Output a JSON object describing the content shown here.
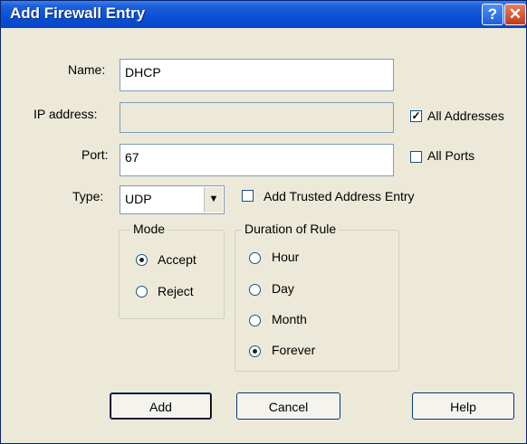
{
  "window": {
    "title": "Add Firewall Entry",
    "help_glyph": "?",
    "close_glyph": "✕"
  },
  "form": {
    "name_label": "Name:",
    "name_value": "DHCP",
    "ip_label": "IP address:",
    "ip_value": "",
    "port_label": "Port:",
    "port_value": "67",
    "type_label": "Type:",
    "type_value": "UDP",
    "all_addresses_label": "All Addresses",
    "all_addresses_checked": true,
    "all_ports_label": "All Ports",
    "all_ports_checked": false,
    "trusted_label": "Add Trusted Address Entry",
    "trusted_checked": false
  },
  "mode": {
    "title": "Mode",
    "accept_label": "Accept",
    "reject_label": "Reject",
    "selected": "Accept"
  },
  "duration": {
    "title": "Duration of Rule",
    "hour_label": "Hour",
    "day_label": "Day",
    "month_label": "Month",
    "forever_label": "Forever",
    "selected": "Forever"
  },
  "buttons": {
    "add": "Add",
    "cancel": "Cancel",
    "help": "Help"
  },
  "colors": {
    "titlebar": "#0a4fd4",
    "dialog_bg": "#ece9d8",
    "field_border": "#7f9db9"
  }
}
